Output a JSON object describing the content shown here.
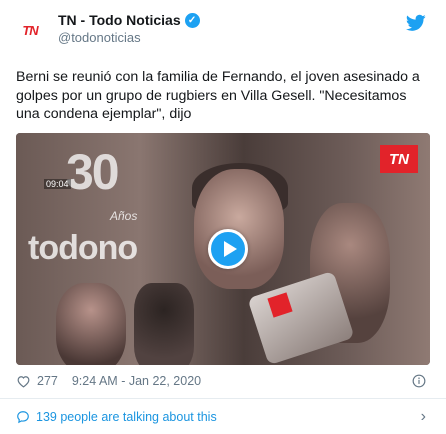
{
  "tweet": {
    "author_name": "TN - Todo Noticias",
    "handle": "@todonoticias",
    "avatar_text": "TN",
    "text": "Berni se reunió con la familia de Fernando, el joven asesinado a golpes por un grupo de rugbiers en Villa Gesell. \"Necesitamos una condena ejemplar\", dijo",
    "likes": "277",
    "time": "9:24 AM - Jan 22, 2020",
    "talking": "139 people are talking about this"
  },
  "media": {
    "banner_number": "30",
    "banner_time": "09:04",
    "banner_sub": "Años",
    "watermark": "todono",
    "corner_logo": "TN"
  },
  "icons": {
    "verified": "verified-badge-icon",
    "twitter": "twitter-bird-icon",
    "play": "play-icon",
    "heart": "heart-icon",
    "info": "info-icon",
    "bubble": "speech-bubble-icon",
    "chevron": "chevron-right-icon"
  },
  "colors": {
    "twitter_blue": "#1da1f2",
    "link_blue": "#1b95e0",
    "muted": "#657786",
    "tn_red": "#e2232a"
  }
}
